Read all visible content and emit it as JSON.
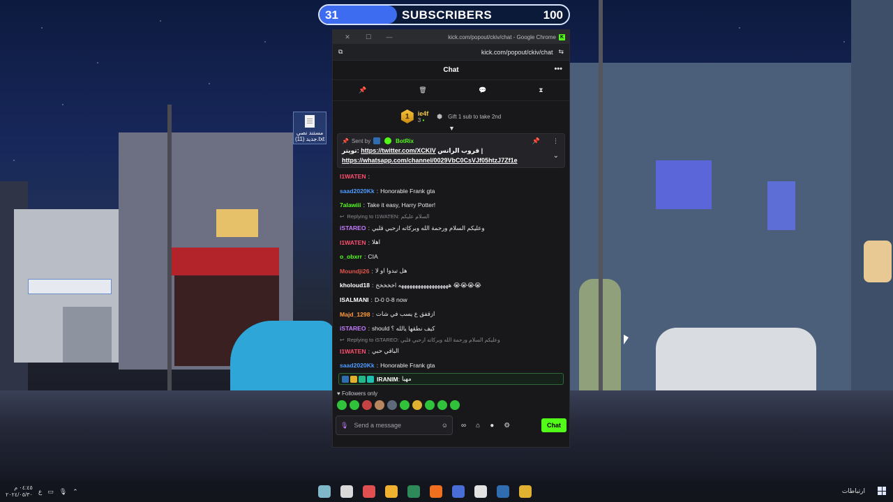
{
  "goal": {
    "current": "31",
    "title": "SUBSCRIBERS",
    "target": "100",
    "progress_fraction": 0.31,
    "fill_color": "#3d6cf0"
  },
  "window": {
    "title": "kick.com/popout/ckiv/chat - Google Chrome",
    "url": "kick.com/popout/ckiv/chat",
    "close_icon": "close-icon",
    "maximize_icon": "maximize-icon",
    "minimize_icon": "minimize-icon"
  },
  "chat": {
    "header_title": "Chat",
    "more": "•••",
    "tools": [
      "pin-icon",
      "trash-icon",
      "chat-bubble-icon",
      "hourglass-icon"
    ],
    "leaderboard": {
      "rank": "1",
      "name": "ie4f",
      "count": "3",
      "gift_text": "Gift 1 sub to take 2nd"
    },
    "pinned": {
      "sent_by_label": "Sent by",
      "bot_name": "BotRix",
      "line1_text": "قروب الراتس |",
      "line1_prefix": "تويتر:",
      "twitter_link": "https://twitter.com/XCKIV",
      "whatsapp_link": "https://whatsapp.com/channel/0029VbC0CsVJf05htzJ7Zf1e"
    },
    "messages": [
      {
        "user": "I1WATEN",
        "color": "#ff4d6d",
        "text": "",
        "kind": "msg"
      },
      {
        "user": "saad2020Kk",
        "color": "#4d9dff",
        "text": "Honorable Frank gta",
        "kind": "msg"
      },
      {
        "user": "7alawiii",
        "color": "#53fc18",
        "text": "Take it easy, Harry Potter!",
        "kind": "msg"
      },
      {
        "reply_to": "Replying to I1WATEN: السلام عليكم",
        "kind": "reply"
      },
      {
        "user": "iSTAREO",
        "color": "#c77dff",
        "text": "وعليكم السلام ورحمة الله وبركاته ارحبي قلبي",
        "kind": "msg"
      },
      {
        "user": "I1WATEN",
        "color": "#ff4d6d",
        "text": "اهلا",
        "kind": "msg"
      },
      {
        "user": "o_obxrr",
        "color": "#53fc18",
        "text": "CIA",
        "kind": "msg"
      },
      {
        "user": "Moundji26",
        "color": "#e0554a",
        "text": "هل تبدوا او لا",
        "kind": "msg"
      },
      {
        "user": "kholoud18",
        "color": "#ffffff",
        "text": "ههههههههههههههههههه اخخخخخ 😭😭😭😭",
        "kind": "msg"
      },
      {
        "user": "ISALMANI",
        "color": "#ffffff",
        "text": "D-0 0-8 now",
        "kind": "msg"
      },
      {
        "user": "Majd_1298",
        "color": "#ff9a3c",
        "text": "ازقفق ع يسب في شات",
        "kind": "msg"
      },
      {
        "user": "iSTAREO",
        "color": "#c77dff",
        "text": "should كيف نطقها يالله ؟",
        "kind": "msg"
      },
      {
        "reply_to": "Replying to iSTAREO: وعليكم السلام ورحمة الله وبركاته ارحبي قلبي",
        "kind": "reply"
      },
      {
        "user": "I1WATEN",
        "color": "#ff4d6d",
        "text": "الباقي حبي",
        "kind": "msg"
      },
      {
        "user": "saad2020Kk",
        "color": "#4d9dff",
        "text": "Honorable Frank gta",
        "kind": "msg"
      }
    ],
    "highlight": {
      "user": "IRANIM",
      "text": "مهيا"
    },
    "followers_only": "Followers only",
    "emote_colors": [
      "#2fc23a",
      "#2fc23a",
      "#c74343",
      "#b8855e",
      "#5c6a7a",
      "#2fc23a",
      "#e0b030",
      "#2fc23a",
      "#2fc23a",
      "#2fc23a"
    ],
    "input_placeholder": "Send a message",
    "chat_button": "Chat"
  },
  "desktop": {
    "file_name": "مستند نصي جديد (11).txt"
  },
  "taskbar": {
    "clock_time": "٠٤:٤٥ م",
    "clock_date": "٢٠٢٤/٠٥/٣٠",
    "lang": "ع",
    "network_label": "ارتباطات",
    "app_colors": [
      "#7fb9c9",
      "#d9d9d9",
      "#e05050",
      "#f0b030",
      "#2e8a58",
      "#f07020",
      "#4a6ed8",
      "#e2e2e2",
      "#2f6db0",
      "#e0b030"
    ]
  },
  "colors": {
    "kick_green": "#53fc18",
    "panel_bg": "#18181b"
  }
}
